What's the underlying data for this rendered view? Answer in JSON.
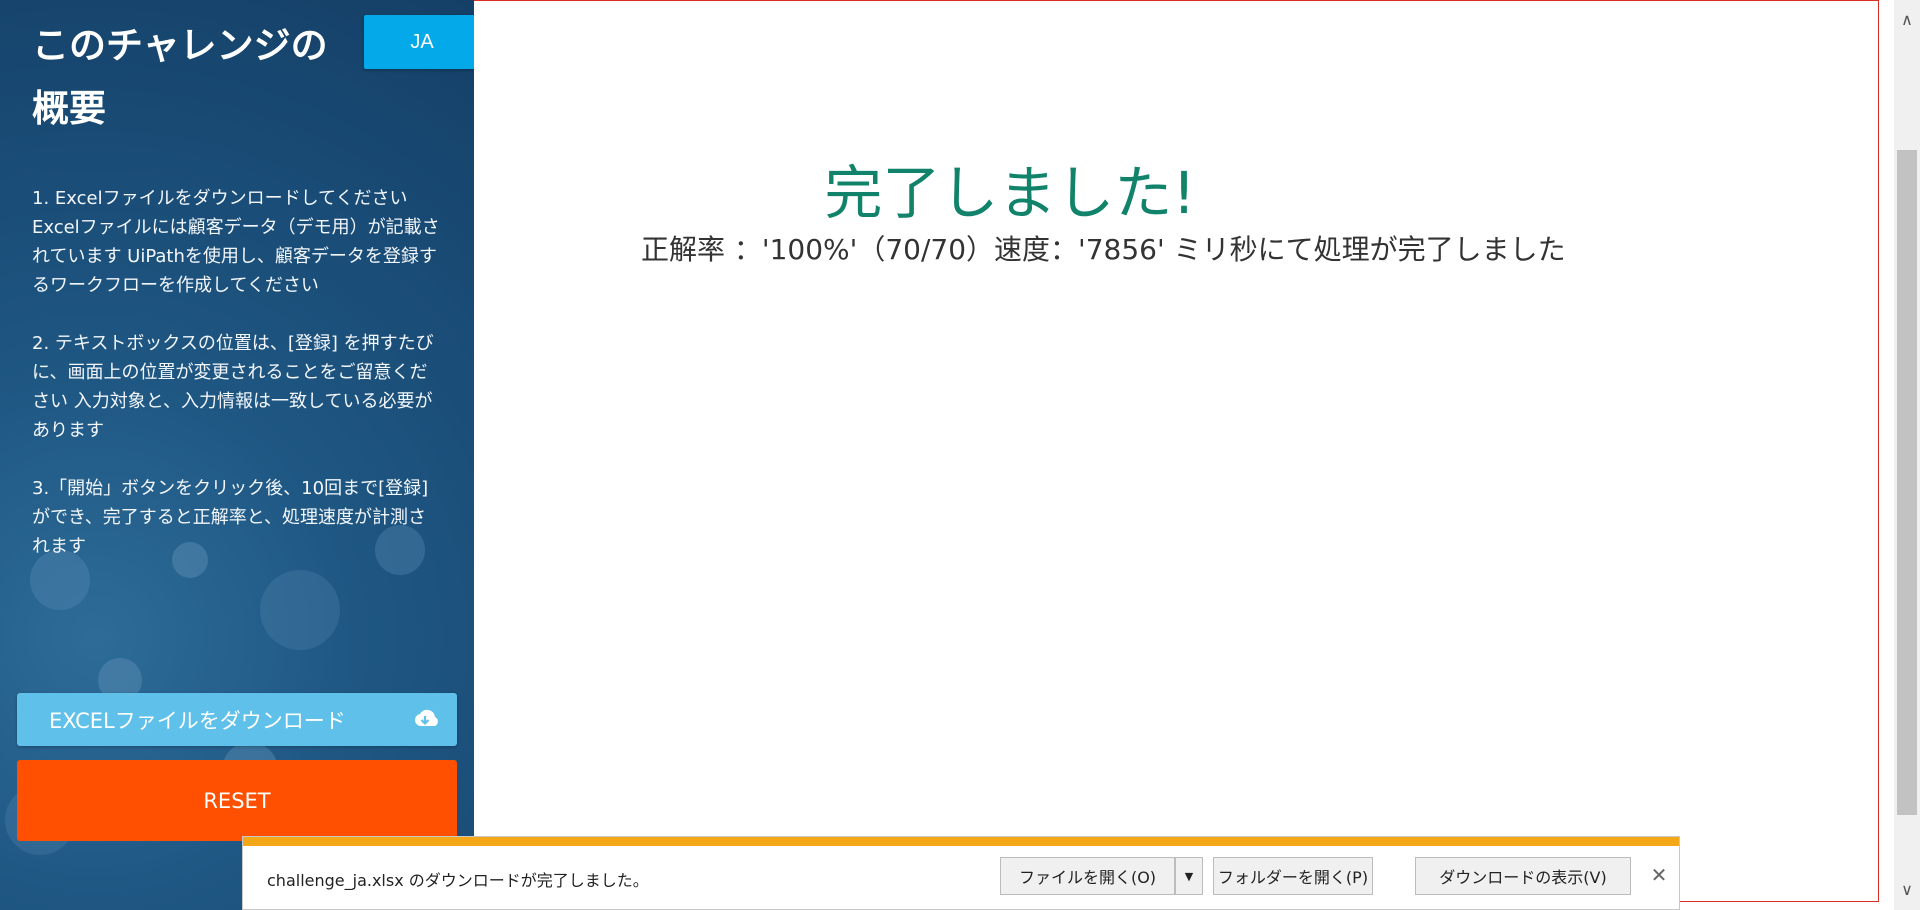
{
  "sidebar": {
    "title": "このチャレンジの概要",
    "language_button": "JA",
    "instructions": [
      "1. Excelファイルをダウンロードしてください Excelファイルには顧客データ（デモ用）が記載されています UiPathを使用し、顧客データを登録するワークフローを作成してください",
      "2. テキストボックスの位置は、[登録] を押すたびに、画面上の位置が変更されることをご留意ください 入力対象と、入力情報は一致している必要があります",
      "3.「開始」ボタンをクリック後、10回まで[登録]ができ、完了すると正解率と、処理速度が計測されます"
    ],
    "download_button": "EXCELファイルをダウンロード",
    "download_icon": "cloud-download-icon",
    "reset_button": "RESET"
  },
  "main": {
    "completion_title": "完了しました!",
    "result_text": "正解率 ：'100%'（70/70）速度：'7856' ミリ秒にて処理が完了しました"
  },
  "download_bar": {
    "message": "challenge_ja.xlsx のダウンロードが完了しました。",
    "open_file_button": "ファイルを開く(O)",
    "dropdown_icon": "caret-down-icon",
    "open_folder_button": "フォルダーを開く(P)",
    "view_downloads_button": "ダウンロードの表示(V)",
    "close_icon": "close-icon",
    "progress": 1.0,
    "progress_color": "#f5a817"
  },
  "colors": {
    "accent_green": "#12836b",
    "language_blue": "#03a9e8",
    "download_blue": "#5fc1ea",
    "reset_orange": "#fe5000",
    "sidebar_blue": "#1f5783"
  }
}
